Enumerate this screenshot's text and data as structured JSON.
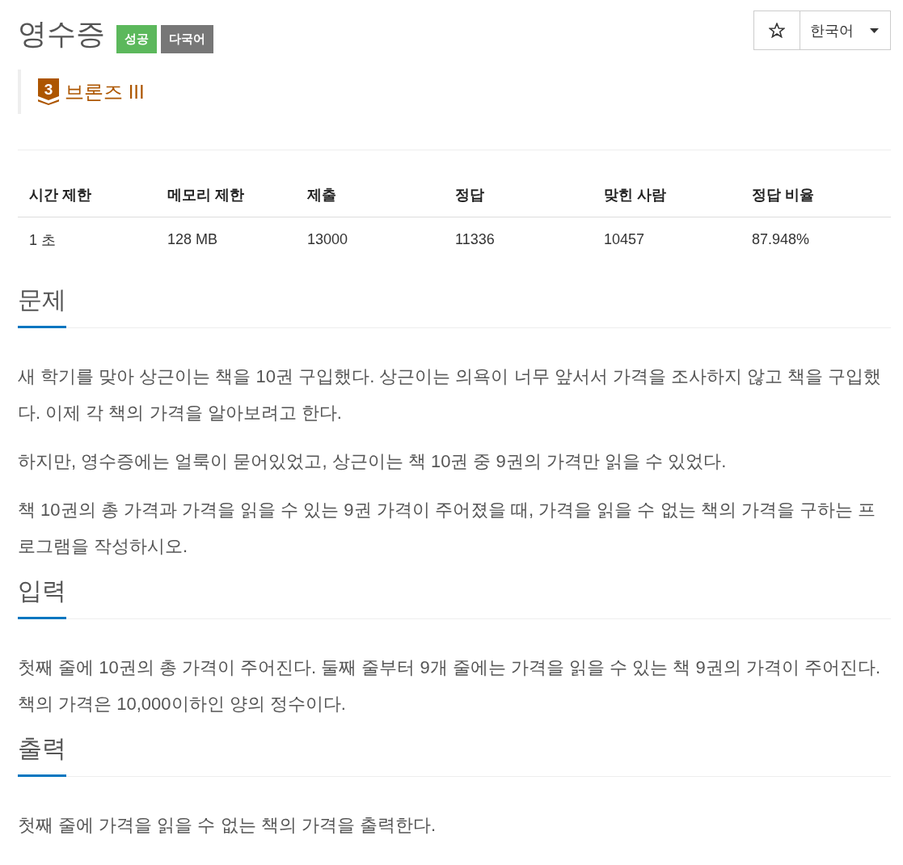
{
  "problem": {
    "title": "영수증",
    "labels": [
      {
        "text": "성공",
        "color": "#5cb85c"
      },
      {
        "text": "다국어",
        "color": "#777777"
      }
    ]
  },
  "toolbar": {
    "starred": false,
    "language": "한국어"
  },
  "tier": {
    "level": "3",
    "name": "브론즈 III"
  },
  "limits_table": {
    "columns": [
      "시간 제한",
      "메모리 제한",
      "제출",
      "정답",
      "맞힌 사람",
      "정답 비율"
    ],
    "rows": [
      [
        "1 초",
        "128 MB",
        "13000",
        "11336",
        "10457",
        "87.948%"
      ]
    ]
  },
  "sections": [
    {
      "heading": "문제",
      "paragraphs": [
        "새 학기를 맞아 상근이는 책을 10권 구입했다. 상근이는 의욕이 너무 앞서서 가격을 조사하지 않고 책을 구입했다. 이제 각 책의 가격을 알아보려고 한다.",
        "하지만, 영수증에는 얼룩이 묻어있었고, 상근이는 책 10권 중 9권의 가격만 읽을 수 있었다.",
        "책 10권의 총 가격과 가격을 읽을 수 있는 9권 가격이 주어졌을 때, 가격을 읽을 수 없는 책의 가격을 구하는 프로그램을 작성하시오."
      ]
    },
    {
      "heading": "입력",
      "paragraphs": [
        "첫째 줄에 10권의 총 가격이 주어진다. 둘째 줄부터 9개 줄에는 가격을 읽을 수 있는 책 9권의 가격이 주어진다. 책의 가격은 10,000이하인 양의 정수이다."
      ]
    },
    {
      "heading": "출력",
      "paragraphs": [
        "첫째 줄에 가격을 읽을 수 없는 책의 가격을 출력한다."
      ]
    }
  ]
}
